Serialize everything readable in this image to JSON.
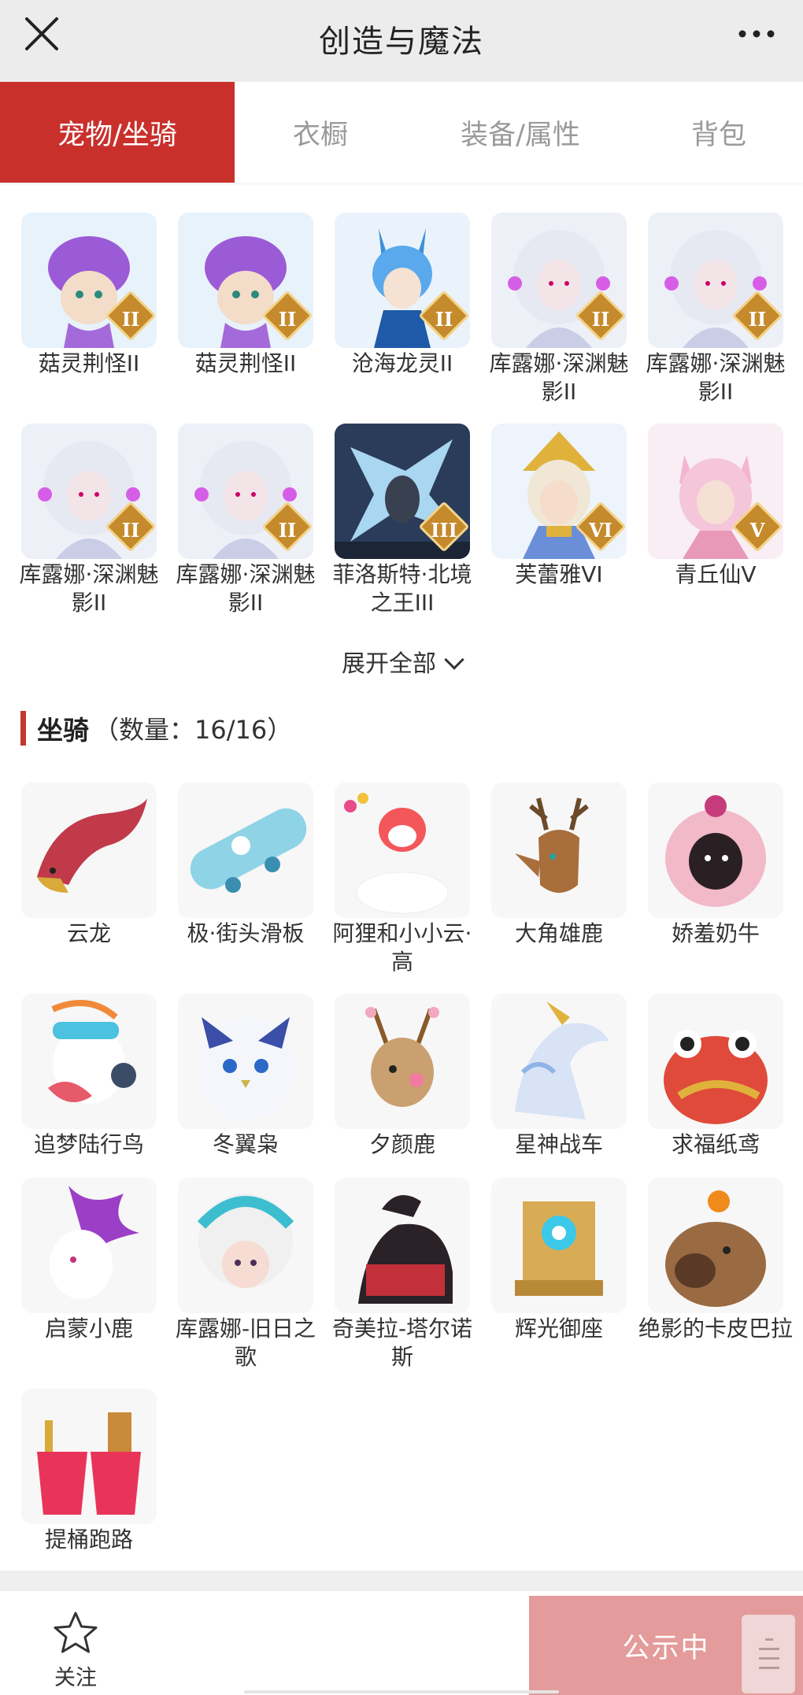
{
  "header": {
    "title": "创造与魔法"
  },
  "tabs": [
    {
      "label": "宠物/坐骑",
      "active": true
    },
    {
      "label": "衣橱",
      "active": false
    },
    {
      "label": "装备/属性",
      "active": false
    },
    {
      "label": "背包",
      "active": false
    }
  ],
  "pets": [
    {
      "name": "菇灵荆怪II",
      "badge": "II",
      "icon": "purple-mushroom-creature"
    },
    {
      "name": "菇灵荆怪II",
      "badge": "II",
      "icon": "purple-mushroom-creature"
    },
    {
      "name": "沧海龙灵II",
      "badge": "II",
      "icon": "blue-dragon-spirit"
    },
    {
      "name": "库露娜·深渊魅影II",
      "badge": "II",
      "icon": "white-haired-spirit"
    },
    {
      "name": "库露娜·深渊魅影II",
      "badge": "II",
      "icon": "white-haired-spirit"
    },
    {
      "name": "库露娜·深渊魅影II",
      "badge": "II",
      "icon": "white-haired-spirit"
    },
    {
      "name": "库露娜·深渊魅影II",
      "badge": "II",
      "icon": "white-haired-spirit"
    },
    {
      "name": "菲洛斯特·北境之王III",
      "badge": "III",
      "icon": "ice-king"
    },
    {
      "name": "芙蕾雅VI",
      "badge": "VI",
      "icon": "golden-helm-maiden"
    },
    {
      "name": "青丘仙V",
      "badge": "V",
      "icon": "fox-fairy"
    }
  ],
  "expand_label": "展开全部",
  "mounts_section": {
    "title": "坐骑",
    "count": "（数量：16/16）"
  },
  "mounts": [
    {
      "name": "云龙",
      "icon": "red-dragon"
    },
    {
      "name": "极·街头滑板",
      "icon": "skateboard"
    },
    {
      "name": "阿狸和小小云·高",
      "icon": "fox-on-cloud"
    },
    {
      "name": "大角雄鹿",
      "icon": "stag"
    },
    {
      "name": "娇羞奶牛",
      "icon": "pink-cow"
    },
    {
      "name": "追梦陆行鸟",
      "icon": "ostrich-headphones"
    },
    {
      "name": "冬翼枭",
      "icon": "snow-owl"
    },
    {
      "name": "夕颜鹿",
      "icon": "blossom-deer"
    },
    {
      "name": "星神战车",
      "icon": "ice-horse"
    },
    {
      "name": "求福纸鸢",
      "icon": "goldfish-kite"
    },
    {
      "name": "启蒙小鹿",
      "icon": "white-purple-deer"
    },
    {
      "name": "库露娜-旧日之歌",
      "icon": "cloud-girl"
    },
    {
      "name": "奇美拉-塔尔诺斯",
      "icon": "chimera"
    },
    {
      "name": "辉光御座",
      "icon": "golden-throne"
    },
    {
      "name": "绝影的卡皮巴拉",
      "icon": "capybara"
    },
    {
      "name": "提桶跑路",
      "icon": "red-buckets"
    }
  ],
  "bottom": {
    "follow_label": "关注",
    "status_label": "公示中"
  },
  "colors": {
    "accent": "#c9302c",
    "publish": "#e49b9b"
  }
}
